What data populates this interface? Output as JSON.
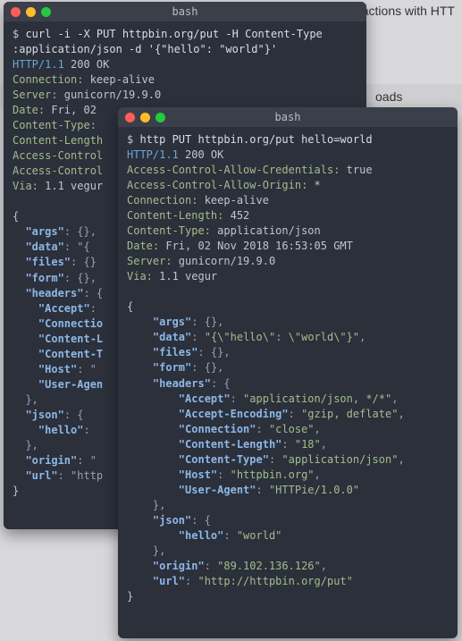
{
  "background": {
    "text_fragment_top": "ractions with HTT",
    "text_fragment_bar": "oads"
  },
  "terminal1": {
    "title": "bash",
    "prompt": "$ ",
    "command_l1": "curl -i -X PUT httpbin.org/put -H Content-Type",
    "command_l2": ":application/json -d '{\"hello\": \"world\"}'",
    "resp_http": "HTTP/1.1",
    "resp_status": "200 OK",
    "h_conn_name": "Connection:",
    "h_conn_val": " keep-alive",
    "h_server_name": "Server:",
    "h_server_val": " gunicorn/19.9.0",
    "h_date_name": "Date:",
    "h_date_val": " Fri, 02 ",
    "h_ctype_name": "Content-Type:",
    "h_clen_name": "Content-Length",
    "h_acao_name": "Access-Control",
    "h_acac_name": "Access-Control",
    "h_via_name": "Via:",
    "h_via_val": " 1.1 vegur",
    "json_open": "{",
    "k_args": "\"args\"",
    "v_args": ": {},",
    "k_data": "\"data\"",
    "v_data": ": \"{",
    "k_files": "\"files\"",
    "v_files": ": {}",
    "k_form": "\"form\"",
    "v_form": ": {},",
    "k_headers": "\"headers\"",
    "v_headers": ": {",
    "k_accept": "\"Accept\"",
    "v_accept": ":",
    "k_connec": "\"Connectio",
    "k_cl": "\"Content-L",
    "k_ct": "\"Content-T",
    "k_host": "\"Host\"",
    "v_host": ": \"",
    "k_ua": "\"User-Agen",
    "closebr": "},",
    "k_json": "\"json\"",
    "v_json": ": {",
    "k_hello": "\"hello\"",
    "v_hello": ":",
    "k_origin": "\"origin\"",
    "v_origin": ": \"",
    "k_url": "\"url\"",
    "v_url": ": \"http",
    "json_close": "}"
  },
  "terminal2": {
    "title": "bash",
    "prompt": "$ ",
    "command": "http PUT httpbin.org/put hello=world",
    "resp_http": "HTTP/1.1",
    "resp_status": "200 OK",
    "h_acac_name": "Access-Control-Allow-Credentials:",
    "h_acac_val": " true",
    "h_acao_name": "Access-Control-Allow-Origin:",
    "h_acao_val": " *",
    "h_conn_name": "Connection:",
    "h_conn_val": " keep-alive",
    "h_clen_name": "Content-Length:",
    "h_clen_val": " 452",
    "h_ctype_name": "Content-Type:",
    "h_ctype_val": " application/json",
    "h_date_name": "Date:",
    "h_date_val": " Fri, 02 Nov 2018 16:53:05 GMT",
    "h_server_name": "Server:",
    "h_server_val": " gunicorn/19.9.0",
    "h_via_name": "Via:",
    "h_via_val": " 1.1 vegur",
    "json_open": "{",
    "k_args": "\"args\"",
    "v_args": ": {},",
    "k_data": "\"data\"",
    "v_data": ": ",
    "s_data": "\"{\\\"hello\\\": \\\"world\\\"}\"",
    "comma": ",",
    "k_files": "\"files\"",
    "v_files": ": {},",
    "k_form": "\"form\"",
    "v_form": ": {},",
    "k_headers": "\"headers\"",
    "v_headers": ": {",
    "k_accept": "\"Accept\"",
    "s_accept": "\"application/json, */*\"",
    "k_acceptenc": "\"Accept-Encoding\"",
    "s_acceptenc": "\"gzip, deflate\"",
    "k_connec": "\"Connection\"",
    "s_connec": "\"close\"",
    "k_cl": "\"Content-Length\"",
    "s_cl": "\"18\"",
    "k_ct": "\"Content-Type\"",
    "s_ct": "\"application/json\"",
    "k_host": "\"Host\"",
    "s_host": "\"httpbin.org\"",
    "k_ua": "\"User-Agent\"",
    "s_ua": "\"HTTPie/1.0.0\"",
    "closebr": "},",
    "k_json": "\"json\"",
    "v_json": ": {",
    "k_hello": "\"hello\"",
    "s_hello": "\"world\"",
    "k_origin": "\"origin\"",
    "s_origin": "\"89.102.136.126\"",
    "k_url": "\"url\"",
    "s_url": "\"http://httpbin.org/put\"",
    "json_close": "}",
    "colon_sp": ": "
  }
}
